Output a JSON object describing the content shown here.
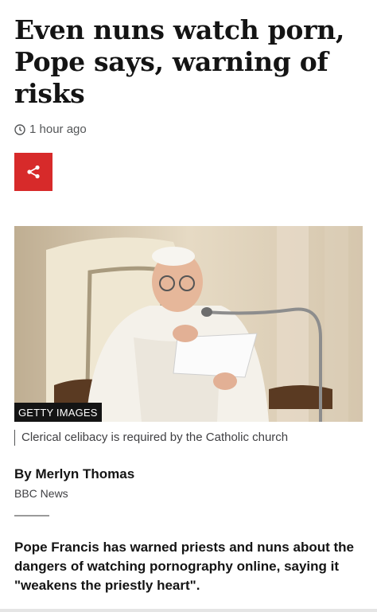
{
  "article": {
    "headline_line1": "Even nuns watch porn,",
    "headline_line2": "Pope says, warning of",
    "headline_line3": "risks",
    "timestamp": "1 hour ago",
    "share_icon": "share-icon",
    "clock_icon": "clock-icon",
    "image": {
      "credit": "GETTY IMAGES",
      "caption": "Clerical celibacy is required by the Catholic church"
    },
    "byline": {
      "author": "By Merlyn Thomas",
      "organisation": "BBC News"
    },
    "intro_line1": "Pope Francis has warned priests and nuns about the",
    "intro_line2": "dangers of watching pornography online, saying it",
    "intro_line3": "\"weakens the priestly heart\"."
  },
  "colors": {
    "share_button": "#d72a2a",
    "text": "#141414",
    "secondary_text": "#545658"
  }
}
